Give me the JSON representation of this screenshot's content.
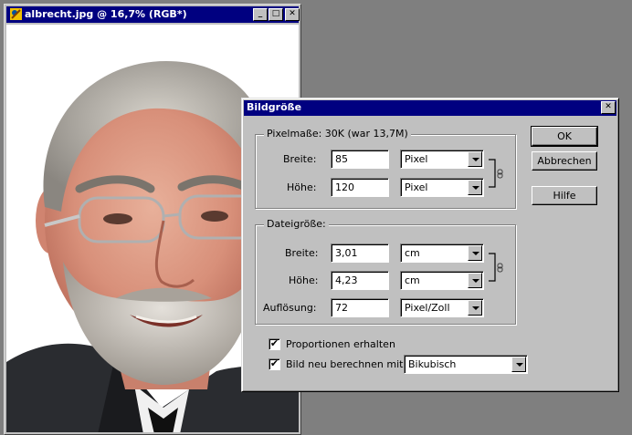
{
  "document_window": {
    "title": "albrecht.jpg @ 16,7% (RGB*)",
    "minimize_glyph": "_",
    "maximize_glyph": "□",
    "close_glyph": "✕"
  },
  "dialog": {
    "title": "Bildgröße",
    "close_glyph": "✕",
    "pixel_dimensions": {
      "legend": "Pixelmaße: 30K (war 13,7M)",
      "width_label": "Breite:",
      "width_value": "85",
      "width_unit": "Pixel",
      "height_label": "Höhe:",
      "height_value": "120",
      "height_unit": "Pixel"
    },
    "document_size": {
      "legend": "Dateigröße:",
      "width_label": "Breite:",
      "width_value": "3,01",
      "width_unit": "cm",
      "height_label": "Höhe:",
      "height_value": "4,23",
      "height_unit": "cm",
      "resolution_label": "Auflösung:",
      "resolution_value": "72",
      "resolution_unit": "Pixel/Zoll"
    },
    "constrain_proportions": {
      "label": "Proportionen erhalten",
      "checked": true
    },
    "resample": {
      "label": "Bild neu berechnen mit:",
      "checked": true,
      "method": "Bikubisch"
    },
    "buttons": {
      "ok": "OK",
      "cancel": "Abbrechen",
      "help": "Hilfe"
    }
  }
}
